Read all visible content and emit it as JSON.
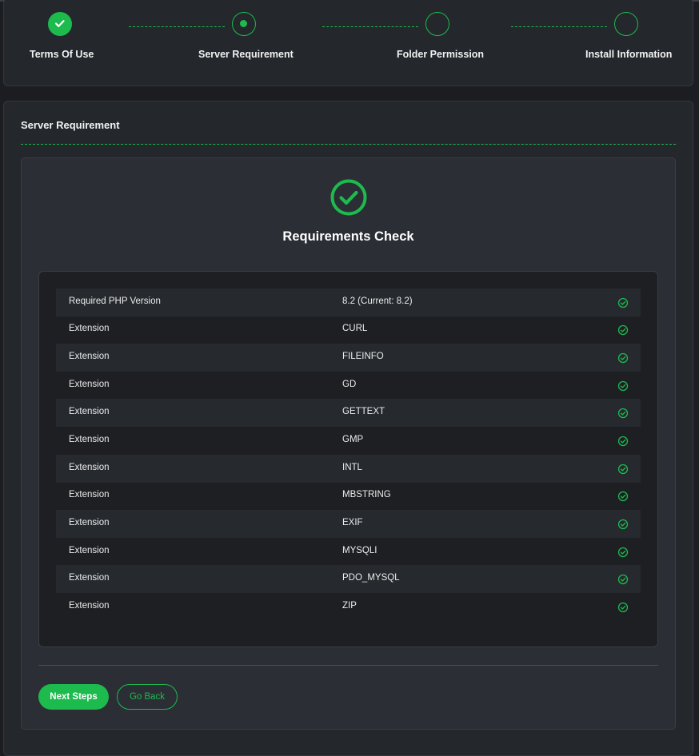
{
  "stepper": {
    "steps": [
      {
        "label": "Terms Of Use",
        "state": "done"
      },
      {
        "label": "Server Requirement",
        "state": "current"
      },
      {
        "label": "Folder Permission",
        "state": "pending"
      },
      {
        "label": "Install Information",
        "state": "pending"
      }
    ]
  },
  "section": {
    "title": "Server Requirement",
    "heading": "Requirements Check"
  },
  "requirements": [
    {
      "name": "Required PHP Version",
      "value": "8.2 (Current: 8.2)",
      "status": "ok"
    },
    {
      "name": "Extension",
      "value": "CURL",
      "status": "ok"
    },
    {
      "name": "Extension",
      "value": "FILEINFO",
      "status": "ok"
    },
    {
      "name": "Extension",
      "value": "GD",
      "status": "ok"
    },
    {
      "name": "Extension",
      "value": "GETTEXT",
      "status": "ok"
    },
    {
      "name": "Extension",
      "value": "GMP",
      "status": "ok"
    },
    {
      "name": "Extension",
      "value": "INTL",
      "status": "ok"
    },
    {
      "name": "Extension",
      "value": "MBSTRING",
      "status": "ok"
    },
    {
      "name": "Extension",
      "value": "EXIF",
      "status": "ok"
    },
    {
      "name": "Extension",
      "value": "MYSQLI",
      "status": "ok"
    },
    {
      "name": "Extension",
      "value": "PDO_MYSQL",
      "status": "ok"
    },
    {
      "name": "Extension",
      "value": "ZIP",
      "status": "ok"
    }
  ],
  "buttons": {
    "next": "Next Steps",
    "back": "Go Back"
  },
  "colors": {
    "accent": "#1dba4e",
    "background": "#1b1d21",
    "card": "#24272c"
  },
  "icons": {
    "step_done": "check-icon",
    "step_current": "dot-icon",
    "status_ok": "check-circle-icon",
    "hero": "check-circle-icon"
  }
}
